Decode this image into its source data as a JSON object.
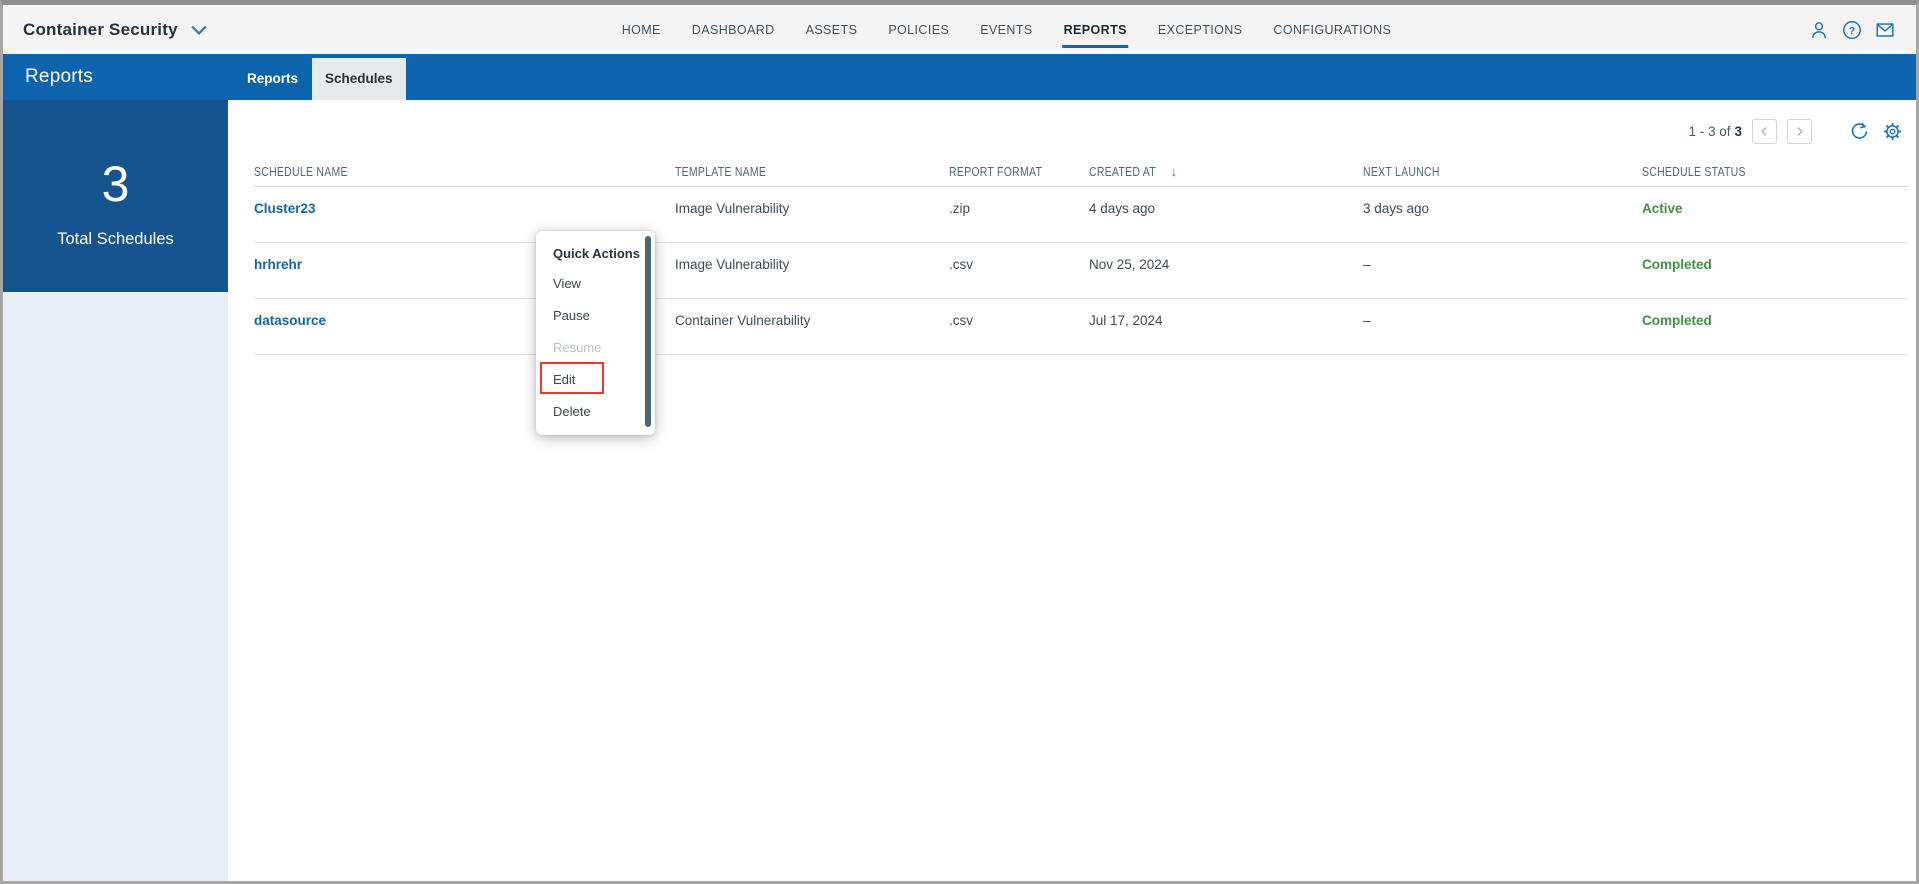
{
  "app_header": {
    "product_title": "Container Security",
    "nav_items": [
      {
        "label": "HOME"
      },
      {
        "label": "DASHBOARD"
      },
      {
        "label": "ASSETS"
      },
      {
        "label": "POLICIES"
      },
      {
        "label": "EVENTS"
      },
      {
        "label": "REPORTS"
      },
      {
        "label": "EXCEPTIONS"
      },
      {
        "label": "CONFIGURATIONS"
      }
    ]
  },
  "page_header": {
    "title": "Reports",
    "tabs": [
      {
        "label": "Reports"
      },
      {
        "label": "Schedules"
      }
    ],
    "active_tab": "Schedules"
  },
  "sidebar": {
    "stat_value": "3",
    "stat_label": "Total Schedules"
  },
  "toolbar": {
    "pagination_range": "1 - 3 of",
    "pagination_total": "3"
  },
  "table": {
    "columns": [
      {
        "label": "SCHEDULE NAME"
      },
      {
        "label": "TEMPLATE NAME"
      },
      {
        "label": "REPORT FORMAT"
      },
      {
        "label": "CREATED AT",
        "sorted": "desc"
      },
      {
        "label": "NEXT LAUNCH"
      },
      {
        "label": "SCHEDULE STATUS"
      }
    ],
    "rows": [
      {
        "schedule_name": "Cluster23",
        "template_name": "Image Vulnerability",
        "report_format": ".zip",
        "created_at": "4 days ago",
        "next_launch": "3 days ago",
        "schedule_status": "Active"
      },
      {
        "schedule_name": "hrhrehr",
        "template_name": "Image Vulnerability",
        "report_format": ".csv",
        "created_at": "Nov 25, 2024",
        "next_launch": "–",
        "schedule_status": "Completed"
      },
      {
        "schedule_name": "datasource",
        "template_name": "Container Vulnerability",
        "report_format": ".csv",
        "created_at": "Jul 17, 2024",
        "next_launch": "–",
        "schedule_status": "Completed"
      }
    ]
  },
  "quick_actions_menu": {
    "title": "Quick Actions",
    "items": [
      {
        "label": "View"
      },
      {
        "label": "Pause"
      },
      {
        "label": "Resume",
        "disabled": true
      },
      {
        "label": "Edit",
        "highlighted": true
      },
      {
        "label": "Delete"
      }
    ]
  },
  "colors": {
    "accent_blue": "#0c63ae",
    "link_blue": "#1266a8",
    "status_green": "#3f9143",
    "highlight_red": "#e8392e",
    "stat_card_blue": "#15548e"
  }
}
